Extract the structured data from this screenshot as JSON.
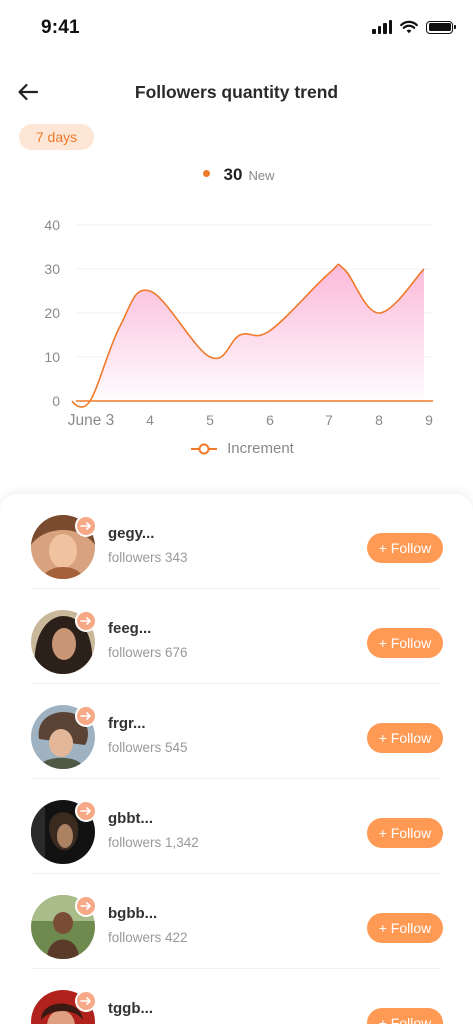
{
  "status_bar": {
    "time": "9:41",
    "icons": [
      "signal-icon",
      "wifi-icon",
      "battery-icon"
    ]
  },
  "header": {
    "title": "Followers quantity trend",
    "back_icon": "arrow-left-icon"
  },
  "period": {
    "label": "7 days"
  },
  "summary": {
    "value": "30",
    "label": "New"
  },
  "colors": {
    "accent": "#f07a2a",
    "follow_button": "#ff9a55",
    "chip_bg": "#fde6d6",
    "area_top": "#fbb6d8",
    "area_bottom": "#ffffff"
  },
  "chart_data": {
    "type": "area",
    "x": [
      "June 3",
      "4",
      "5",
      "6",
      "7",
      "8",
      "9"
    ],
    "series": [
      {
        "name": "Increment",
        "points": [
          {
            "x": 2.7,
            "y": 0
          },
          {
            "x": 3.0,
            "y": 0
          },
          {
            "x": 3.5,
            "y": 17
          },
          {
            "x": 4.0,
            "y": 25
          },
          {
            "x": 5.0,
            "y": 10
          },
          {
            "x": 5.5,
            "y": 15
          },
          {
            "x": 6.0,
            "y": 16
          },
          {
            "x": 7.0,
            "y": 29
          },
          {
            "x": 7.3,
            "y": 30
          },
          {
            "x": 8.0,
            "y": 20
          },
          {
            "x": 8.9,
            "y": 30
          }
        ]
      }
    ],
    "ylim": [
      0,
      40
    ],
    "yticks": [
      0,
      10,
      20,
      30,
      40
    ],
    "grid": true,
    "legend": "bottom-center"
  },
  "legend": {
    "label": "Increment"
  },
  "followers": [
    {
      "name": "gegy...",
      "followers": "followers 343",
      "button": "+ Follow",
      "avatar": "avatar-1"
    },
    {
      "name": "feeg...",
      "followers": "followers 676",
      "button": "+ Follow",
      "avatar": "avatar-2"
    },
    {
      "name": "frgr...",
      "followers": "followers 545",
      "button": "+ Follow",
      "avatar": "avatar-3"
    },
    {
      "name": "gbbt...",
      "followers": "followers 1,342",
      "button": "+ Follow",
      "avatar": "avatar-4"
    },
    {
      "name": "bgbb...",
      "followers": "followers 422",
      "button": "+ Follow",
      "avatar": "avatar-5"
    },
    {
      "name": "tggb...",
      "followers": "",
      "button": "+ Follow",
      "avatar": "avatar-6"
    }
  ]
}
